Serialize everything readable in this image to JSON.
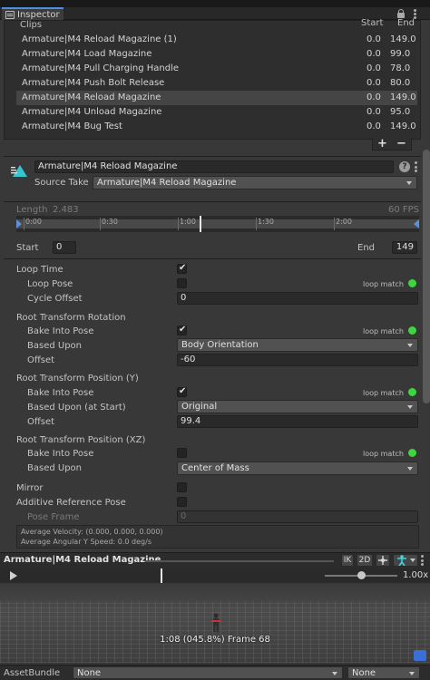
{
  "window": {
    "tab_title": "Inspector"
  },
  "clips": {
    "header": "Clips",
    "col_start": "Start",
    "col_end": "End",
    "rows": [
      {
        "name": "Armature|M4 Reload Magazine (1)",
        "start": "0.0",
        "end": "149.0"
      },
      {
        "name": "Armature|M4 Load Magazine",
        "start": "0.0",
        "end": "99.0"
      },
      {
        "name": "Armature|M4 Pull Charging Handle",
        "start": "0.0",
        "end": "78.0"
      },
      {
        "name": "Armature|M4 Push Bolt Release",
        "start": "0.0",
        "end": "80.0"
      },
      {
        "name": "Armature|M4 Reload Magazine",
        "start": "0.0",
        "end": "149.0"
      },
      {
        "name": "Armature|M4 Unload Magazine",
        "start": "0.0",
        "end": "95.0"
      },
      {
        "name": "Armature|M4 Bug Test",
        "start": "0.0",
        "end": "149.0"
      }
    ],
    "selected_index": 4,
    "add_label": "+",
    "remove_label": "−"
  },
  "clip": {
    "name": "Armature|M4 Reload Magazine",
    "source_take_label": "Source Take",
    "source_take_value": "Armature|M4 Reload Magazine",
    "length_label": "Length",
    "length_value": "2.483",
    "fps": "60 FPS",
    "ticks": [
      "0:00",
      "0:30",
      "1:00",
      "1:30",
      "2:00"
    ],
    "start_label": "Start",
    "start_value": "0",
    "end_label": "End",
    "end_value": "149"
  },
  "settings": {
    "loop_time": "Loop Time",
    "loop_pose": "Loop Pose",
    "loop_match": "loop match",
    "cycle_offset": "Cycle Offset",
    "cycle_offset_value": "0",
    "rrot_header": "Root Transform Rotation",
    "rrot_bake": "Bake Into Pose",
    "rrot_based": "Based Upon",
    "rrot_based_value": "Body Orientation",
    "rrot_offset": "Offset",
    "rrot_offset_value": "-60",
    "rposy_header": "Root Transform Position (Y)",
    "rposy_bake": "Bake Into Pose",
    "rposy_based": "Based Upon (at Start)",
    "rposy_based_value": "Original",
    "rposy_offset": "Offset",
    "rposy_offset_value": "99.4",
    "rposxz_header": "Root Transform Position (XZ)",
    "rposxz_bake": "Bake Into Pose",
    "rposxz_based": "Based Upon",
    "rposxz_based_value": "Center of Mass",
    "mirror": "Mirror",
    "additive": "Additive Reference Pose",
    "pose_frame": "Pose Frame",
    "pose_frame_value": "0",
    "avg_velocity": "Average Velocity: (0.000, 0.000, 0.000)",
    "avg_angular": "Average Angular Y Speed: 0.0 deg/s"
  },
  "preview": {
    "title": "Armature|M4 Reload Magazine",
    "ik": "IK",
    "mode_2d": "2D",
    "speed": "1.00x",
    "frame_info": "1:08 (045.8%) Frame 68"
  },
  "footer": {
    "label": "AssetBundle",
    "bundle_value": "None",
    "variant_value": "None"
  },
  "colors": {
    "accent": "#4a8fe0",
    "match_ok": "#3fd53f"
  }
}
